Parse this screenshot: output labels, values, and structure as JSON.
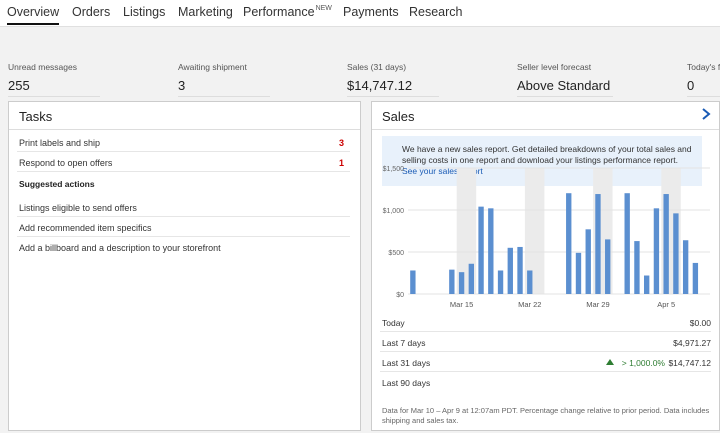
{
  "nav": {
    "tabs": [
      {
        "label": "Overview",
        "active": true
      },
      {
        "label": "Orders"
      },
      {
        "label": "Listings"
      },
      {
        "label": "Marketing"
      },
      {
        "label": "Performance",
        "badge": "NEW"
      },
      {
        "label": "Payments"
      },
      {
        "label": "Research"
      }
    ]
  },
  "summary": [
    {
      "label": "Unread messages",
      "value": "255"
    },
    {
      "label": "Awaiting shipment",
      "value": "3"
    },
    {
      "label": "Sales (31 days)",
      "value": "$14,747.12"
    },
    {
      "label": "Seller level forecast",
      "value": "Above Standard"
    },
    {
      "label": "Today's fe",
      "value": "0"
    }
  ],
  "tasks": {
    "title": "Tasks",
    "items": [
      {
        "label": "Print labels and ship",
        "count": "3"
      },
      {
        "label": "Respond to open offers",
        "count": "1"
      }
    ],
    "suggested_title": "Suggested actions",
    "suggested": [
      {
        "label": "Listings eligible to send offers"
      },
      {
        "label": "Add recommended item specifics"
      },
      {
        "label": "Add a billboard and a description to your storefront"
      }
    ]
  },
  "sales": {
    "title": "Sales",
    "notice": "We have a new sales report. Get detailed breakdowns of your total sales and selling costs in one report and download your listings performance report.",
    "notice_link": "See your sales report",
    "rows": [
      {
        "label": "Today",
        "value": "$0.00",
        "change": ""
      },
      {
        "label": "Last 7 days",
        "value": "$4,971.27",
        "change": ""
      },
      {
        "label": "Last 31 days",
        "value": "$14,747.12",
        "change": "> 1,000.0%"
      },
      {
        "label": "Last 90 days",
        "value": "",
        "change": ""
      }
    ],
    "footnote": "Data for Mar 10 – Apr 9 at 12:07am PDT. Percentage change relative to prior period. Data includes shipping and sales tax."
  },
  "colors": {
    "bar": "#5b8fd0",
    "weekend_shade": "#ebebeb",
    "accent_link": "#1a5bb5",
    "alert": "#cc0000",
    "positive": "#2e7d32"
  },
  "chart_data": {
    "type": "bar",
    "ylim": [
      0,
      1500
    ],
    "yticks": [
      "$1,500",
      "$1,000",
      "$500",
      "$0"
    ],
    "ytick_values": [
      1500,
      1000,
      500,
      0
    ],
    "xticks": [
      {
        "label": "Mar 15",
        "index": 5
      },
      {
        "label": "Mar 22",
        "index": 12
      },
      {
        "label": "Mar 29",
        "index": 19
      },
      {
        "label": "Apr 5",
        "index": 26
      }
    ],
    "categories": [
      "Mar 10",
      "Mar 11",
      "Mar 12",
      "Mar 13",
      "Mar 14",
      "Mar 15",
      "Mar 16",
      "Mar 17",
      "Mar 18",
      "Mar 19",
      "Mar 20",
      "Mar 21",
      "Mar 22",
      "Mar 23",
      "Mar 24",
      "Mar 25",
      "Mar 26",
      "Mar 27",
      "Mar 28",
      "Mar 29",
      "Mar 30",
      "Mar 31",
      "Apr 1",
      "Apr 2",
      "Apr 3",
      "Apr 4",
      "Apr 5",
      "Apr 6",
      "Apr 7",
      "Apr 8",
      "Apr 9"
    ],
    "values": [
      280,
      0,
      0,
      0,
      290,
      260,
      360,
      1040,
      1020,
      280,
      550,
      560,
      280,
      0,
      0,
      0,
      1200,
      490,
      770,
      1190,
      650,
      0,
      1200,
      630,
      220,
      1020,
      1190,
      960,
      640,
      370,
      0
    ],
    "shaded": [
      [
        5,
        6
      ],
      [
        12,
        13
      ],
      [
        19,
        20
      ],
      [
        26,
        27
      ]
    ]
  }
}
